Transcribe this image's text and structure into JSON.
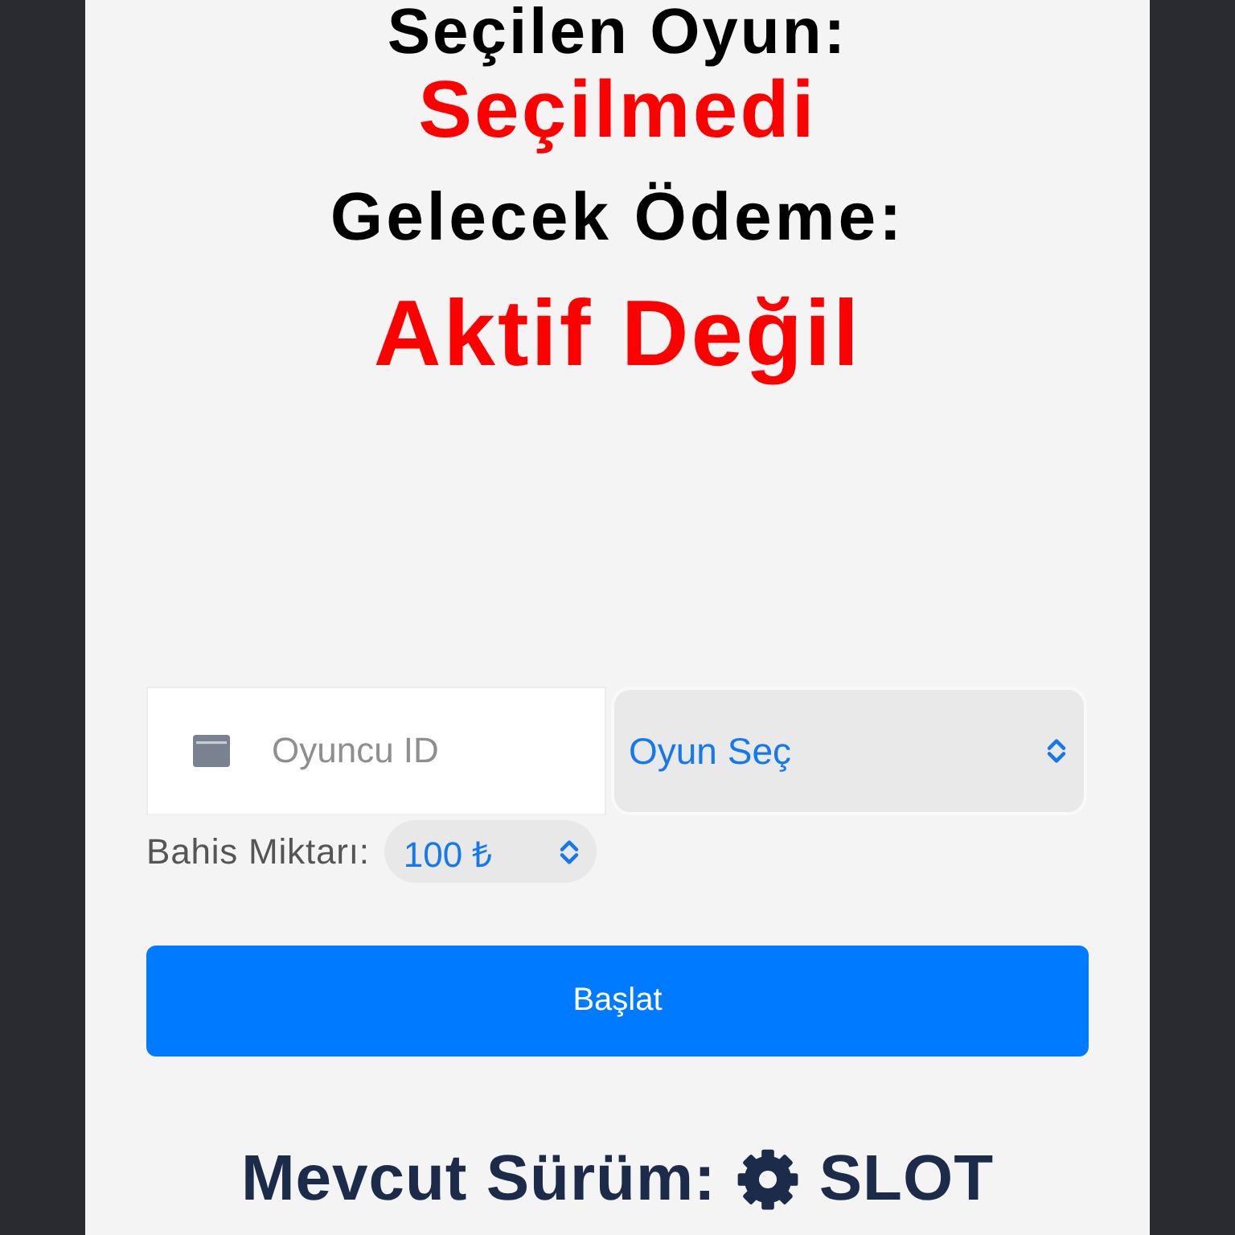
{
  "status": {
    "selected_game_label": "Seçilen Oyun:",
    "selected_game_value": "Seçilmedi",
    "next_payment_label": "Gelecek Ödeme:",
    "next_payment_value": "Aktif Değil"
  },
  "form": {
    "player_id": {
      "placeholder": "Oyuncu ID"
    },
    "game_select": {
      "value": "Oyun Seç"
    },
    "bet": {
      "label": "Bahis Miktarı:",
      "value": "100 ₺"
    },
    "start_button": "Başlat"
  },
  "version": {
    "label": "Mevcut Sürüm:",
    "value": "SLOT"
  }
}
